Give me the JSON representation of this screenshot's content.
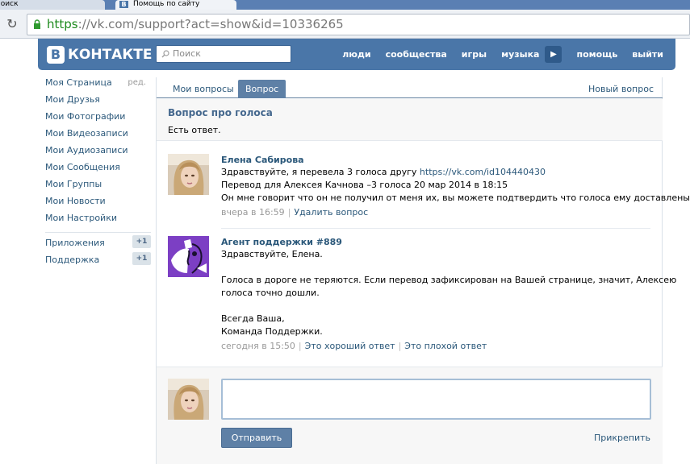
{
  "browser": {
    "tab1_title": "Поиск",
    "tab2_title": "Помощь по сайту",
    "tab2_icon": "В",
    "url_scheme": "https",
    "url_rest": "://vk.com/support?act=show&id=10336265"
  },
  "header": {
    "logo_letter": "В",
    "logo_text": "КОНТАКТЕ",
    "search_placeholder": "Поиск",
    "nav": [
      "люди",
      "сообщества",
      "игры",
      "музыка",
      "помощь",
      "выйти"
    ],
    "play_icon": "▶"
  },
  "leftmenu": {
    "items": [
      {
        "label": "Моя Страница",
        "extra": "ред."
      },
      {
        "label": "Мои Друзья"
      },
      {
        "label": "Мои Фотографии"
      },
      {
        "label": "Мои Видеозаписи"
      },
      {
        "label": "Мои Аудиозаписи"
      },
      {
        "label": "Мои Сообщения"
      },
      {
        "label": "Мои Группы"
      },
      {
        "label": "Мои Новости"
      },
      {
        "label": "Мои Настройки"
      }
    ],
    "apps": [
      {
        "label": "Приложения",
        "badge": "+1"
      },
      {
        "label": "Поддержка",
        "badge": "+1"
      }
    ]
  },
  "tabs": {
    "my_questions": "Мои вопросы",
    "question": "Вопрос",
    "new_question": "Новый вопрос"
  },
  "question": {
    "title": "Вопрос про голоса",
    "status": "Есть ответ."
  },
  "post1": {
    "author": "Елена Сабирова",
    "line1_text": "Здравствуйте, я перевела 3 голоса другу ",
    "line1_link": "https://vk.com/id104440430",
    "line2": "Перевод для Алексея Качнова –3 голоса 20 мар 2014 в 18:15",
    "line3": "Он мне говорит что он не получил от меня их, вы можете подтвердить что голоса ему доставлены?",
    "time": "вчера в 16:59",
    "action": "Удалить вопрос"
  },
  "post2": {
    "author": "Агент поддержки #889",
    "greeting": "Здравствуйте, Елена.",
    "para1": "Голоса в дороге не теряются. Если перевод зафиксирован на Вашей странице, значит, Алексею",
    "para2": "голоса точно дошли.",
    "sign1": "Всегда Ваша,",
    "sign2": "Команда Поддержки.",
    "time": "сегодня в 15:50",
    "good": "Это хороший ответ",
    "bad": "Это плохой ответ"
  },
  "reply": {
    "send": "Отправить",
    "attach": "Прикрепить"
  }
}
